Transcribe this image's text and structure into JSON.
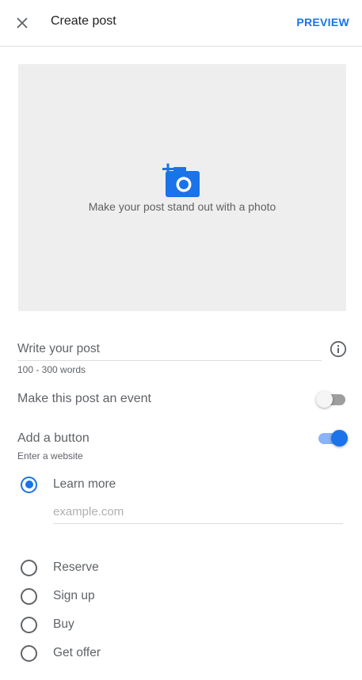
{
  "header": {
    "title": "Create post",
    "preview_label": "PREVIEW",
    "close_icon": "close-icon"
  },
  "photo": {
    "caption": "Make your post stand out with a photo",
    "icon": "add-photo-icon"
  },
  "post": {
    "placeholder": "Write your post",
    "helper": "100 - 300 words",
    "info_icon": "info-icon"
  },
  "event_toggle": {
    "label": "Make this post an event",
    "on": false
  },
  "button_toggle": {
    "label": "Add a button",
    "helper": "Enter a website",
    "on": true
  },
  "button_options": [
    {
      "label": "Learn more",
      "checked": true
    },
    {
      "label": "Reserve",
      "checked": false
    },
    {
      "label": "Sign up",
      "checked": false
    },
    {
      "label": "Buy",
      "checked": false
    },
    {
      "label": "Get offer",
      "checked": false
    }
  ],
  "website": {
    "placeholder": "example.com"
  },
  "colors": {
    "accent": "#1a73e8",
    "accent_light": "#8ab4f8",
    "photo_bg": "#eeeeee"
  }
}
